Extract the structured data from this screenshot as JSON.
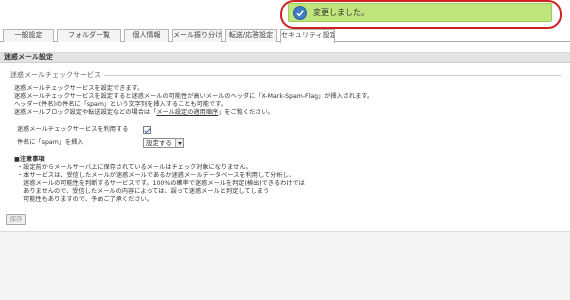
{
  "notification": {
    "message": "変更しました。",
    "icon": "check-circle-icon",
    "highlight_color": "#d02020",
    "background_color": "#bfe57c"
  },
  "tabs": [
    {
      "label": "一般設定",
      "active": false
    },
    {
      "label": "フォルダー覧",
      "active": false
    },
    {
      "label": "個人情報",
      "active": false
    },
    {
      "label": "メール振り分け",
      "active": false
    },
    {
      "label": "転送/応答設定",
      "active": false
    },
    {
      "label": "セキュリティ設定",
      "active": true
    }
  ],
  "section": {
    "title": "迷惑メール設定",
    "legend": "迷惑メールチェックサービス",
    "description": [
      "迷惑メールチェックサービスを設定できます。",
      "迷惑メールチェックサービスを設定すると迷惑メールの可能性が高いメールのヘッダに「X-Mark-Spam-Flag」が挿入されます。",
      "ヘッダー(件名)の件名に「spam」という文字列を挿入することも可能です。"
    ],
    "description_last": {
      "prefix": "迷惑メールブロック設定や転送設定などの場合は「",
      "link": "メール設定の適用順序",
      "suffix": "」をご覧ください。"
    }
  },
  "form": {
    "use_service_label": "迷惑メールチェックサービスを利用する",
    "use_service_checked": true,
    "insert_spam_label": "件名に「spam」を挿入",
    "insert_spam_value": "設定する"
  },
  "notes": {
    "heading": "■注意事項",
    "lines": [
      "・設定前からメールサーバ上に保存されているメールはチェック対象になりません。",
      "・本サービスは、受信したメールが迷惑メールであるか迷惑メールデータベースを利用して分析し、",
      "　迷惑メールの可能性を判断するサービスです。100%の確率で迷惑メールを判定(検出)できるわけでは",
      "　ありませんので、受信したメールの内容によっては、誤って迷惑メールと判定してしまう",
      "　可能性もありますので、予めご了承ください。"
    ]
  },
  "actions": {
    "save_label": "保存"
  }
}
